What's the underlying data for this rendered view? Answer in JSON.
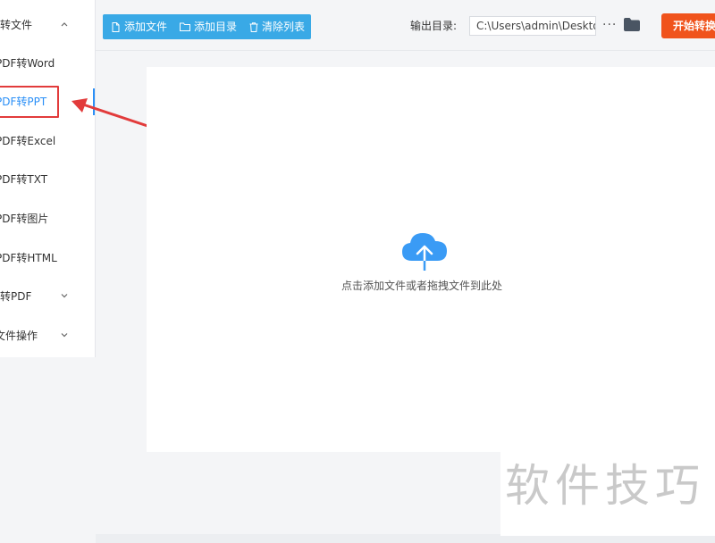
{
  "sidebar": {
    "items": [
      {
        "label": "转文件",
        "type": "group",
        "expanded": true
      },
      {
        "label": "PDF转Word",
        "type": "item"
      },
      {
        "label": "PDF转PPT",
        "type": "item",
        "active": true
      },
      {
        "label": "PDF转Excel",
        "type": "item"
      },
      {
        "label": "PDF转TXT",
        "type": "item"
      },
      {
        "label": "PDF转图片",
        "type": "item"
      },
      {
        "label": "PDF转HTML",
        "type": "item"
      },
      {
        "label": "转PDF",
        "type": "group",
        "expanded": false
      },
      {
        "label": "文件操作",
        "type": "group",
        "expanded": false
      }
    ]
  },
  "toolbar": {
    "add_file": "添加文件",
    "add_dir": "添加目录",
    "clear_list": "清除列表"
  },
  "output": {
    "label": "输出目录:",
    "path": "C:\\Users\\admin\\Deskto",
    "more": "···"
  },
  "actions": {
    "start": "开始转换"
  },
  "dropzone": {
    "hint": "点击添加文件或者拖拽文件到此处"
  },
  "watermark": "软件技巧",
  "colors": {
    "accent_blue": "#2a8ff7",
    "toolbar_blue": "#39a9e6",
    "start_orange": "#f0531c",
    "highlight_red": "#e23b3b"
  }
}
